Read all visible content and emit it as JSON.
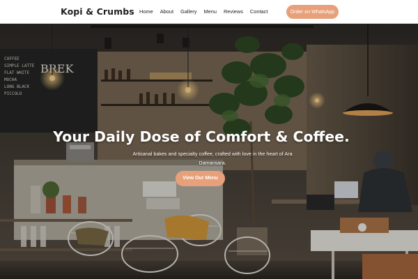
{
  "header": {
    "brand": "Kopi & Crumbs",
    "nav": [
      "Home",
      "About",
      "Gallery",
      "Menu",
      "Reviews",
      "Contact"
    ],
    "cta_label": "Order on WhatsApp"
  },
  "hero": {
    "title": "Your Daily Dose of Comfort & Coffee.",
    "subtitle": "Artisanal bakes and specialty coffee, crafted with love in the heart of Ara Damansara.",
    "cta_label": "View Our Menu",
    "chalkboard_text": "BREK"
  },
  "colors": {
    "accent": "#e7a07a",
    "header_bg": "#ffffff",
    "hero_text": "#ffffff"
  }
}
